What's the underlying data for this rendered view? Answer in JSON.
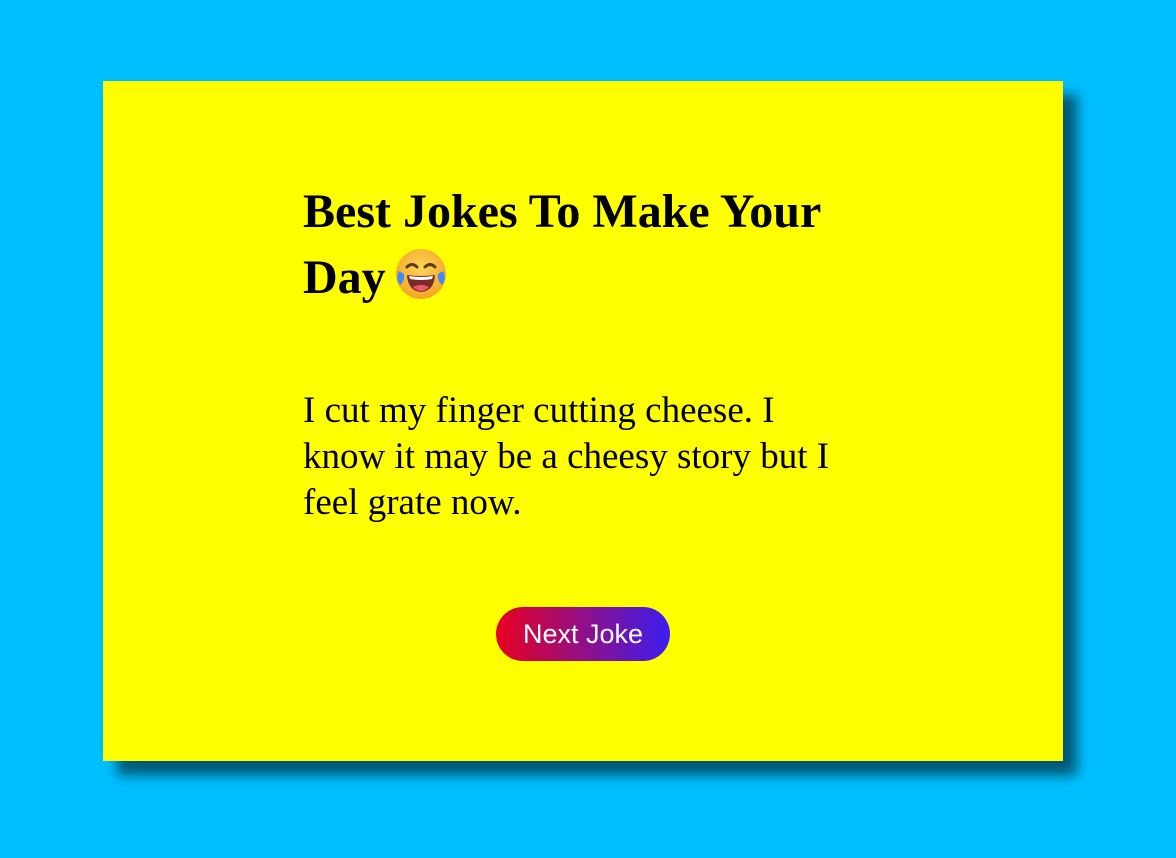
{
  "card": {
    "title": "Best Jokes To Make Your Day",
    "title_icon": "face-with-tears-of-joy-icon",
    "joke": "I cut my finger cutting cheese. I know it may be a cheesy story but I feel grate now.",
    "next_button_label": "Next Joke"
  },
  "colors": {
    "page_background": "#00bfff",
    "card_background": "#ffff00",
    "button_gradient_start": "#e8001f",
    "button_gradient_end": "#3b1ef0"
  }
}
